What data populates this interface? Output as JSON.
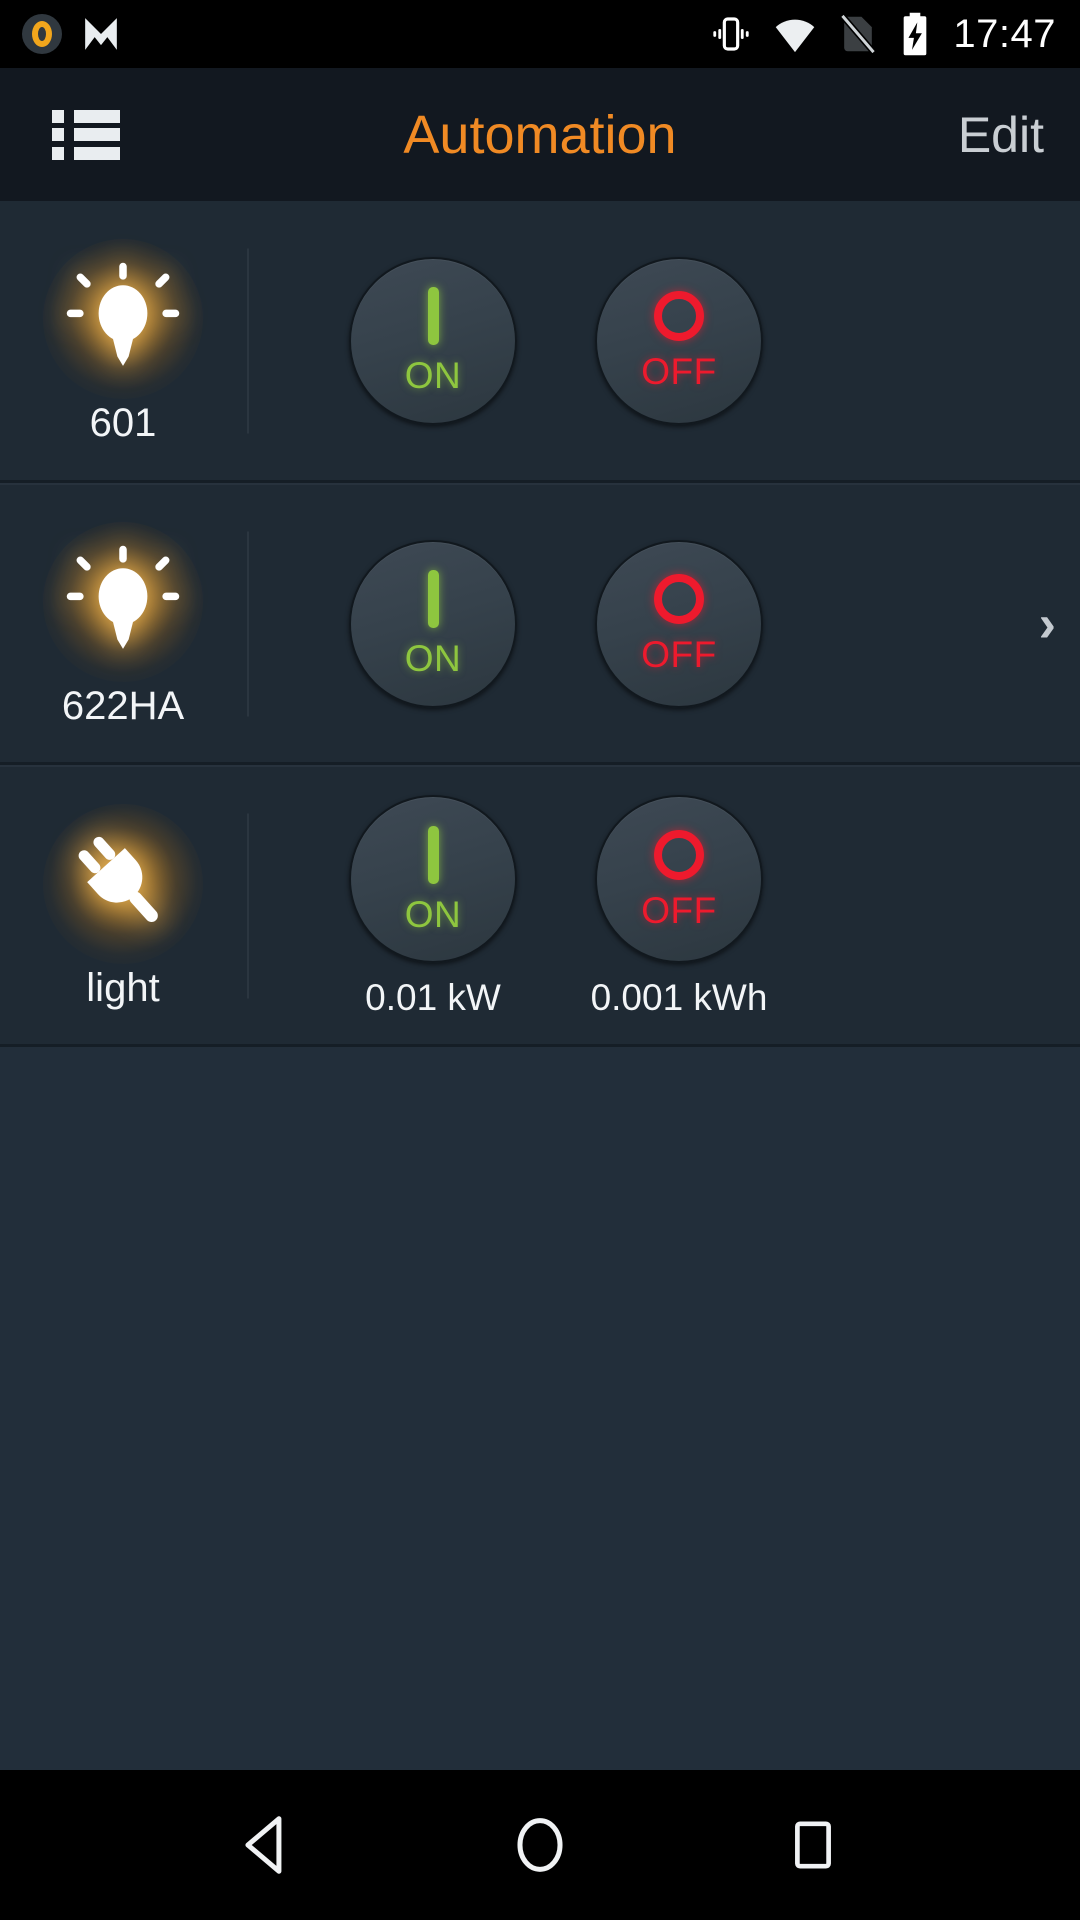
{
  "status_bar": {
    "time": "17:47",
    "icons_left": [
      "app-circle-icon",
      "gmail-m-icon"
    ],
    "icons_right": [
      "vibrate-icon",
      "wifi-icon",
      "no-sim-icon",
      "battery-charging-icon"
    ]
  },
  "app_bar": {
    "menu_icon": "list-menu-icon",
    "title": "Automation",
    "edit_label": "Edit",
    "title_color": "#f08a24",
    "edit_color": "#c9ced3"
  },
  "colors": {
    "background": "#1d2832",
    "row_background": "#1f2a34",
    "on_green": "#8ec63f",
    "off_red": "#ee1a2d",
    "glow_orange": "#ffb22c",
    "accent": "#f08a24"
  },
  "list": {
    "rows": [
      {
        "device_icon": "lightbulb-icon",
        "name": "601",
        "on": {
          "label": "ON",
          "symbol": "power-on-bar-icon"
        },
        "off": {
          "label": "OFF",
          "symbol": "power-off-ring-icon"
        },
        "on_meter": "",
        "off_meter": "",
        "chevron": false
      },
      {
        "device_icon": "lightbulb-icon",
        "name": "622HA",
        "on": {
          "label": "ON",
          "symbol": "power-on-bar-icon"
        },
        "off": {
          "label": "OFF",
          "symbol": "power-off-ring-icon"
        },
        "on_meter": "",
        "off_meter": "",
        "chevron": true,
        "chevron_glyph": "›"
      },
      {
        "device_icon": "power-plug-icon",
        "name": "light",
        "on": {
          "label": "ON",
          "symbol": "power-on-bar-icon"
        },
        "off": {
          "label": "OFF",
          "symbol": "power-off-ring-icon"
        },
        "on_meter": "0.01 kW",
        "off_meter": "0.001 kWh",
        "chevron": false
      }
    ]
  },
  "nav_bar": {
    "back": "back-triangle-icon",
    "home": "home-circle-icon",
    "recents": "recents-square-icon"
  }
}
